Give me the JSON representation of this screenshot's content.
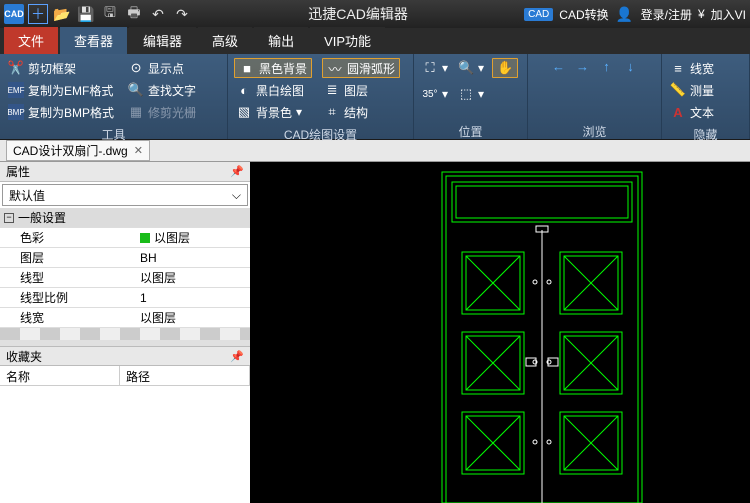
{
  "app": {
    "title": "迅捷CAD编辑器"
  },
  "titlebar_right": {
    "cad_label": "CAD",
    "convert": "CAD转换",
    "login": "登录/注册",
    "vip_prefix": "¥",
    "vip": "加入VI"
  },
  "tabs": {
    "file": "文件",
    "viewer": "查看器",
    "editor": "编辑器",
    "advanced": "高级",
    "output": "输出",
    "vip": "VIP功能"
  },
  "ribbon": {
    "group1": {
      "label": "工具",
      "items": [
        "剪切框架",
        "复制为EMF格式",
        "复制为BMP格式",
        "显示点",
        "查找文字",
        "修剪光栅"
      ]
    },
    "group2": {
      "label": "CAD绘图设置",
      "items": [
        "黑色背景",
        "黑白绘图",
        "背景色",
        "圆滑弧形",
        "图层",
        "结构"
      ]
    },
    "group3": {
      "label": "位置"
    },
    "group4": {
      "label": "浏览"
    },
    "group5": {
      "label": "隐藏",
      "items": [
        "线宽",
        "测量",
        "文本"
      ]
    }
  },
  "document": {
    "tab": "CAD设计双扇门-.dwg"
  },
  "props": {
    "title": "属性",
    "default": "默认值",
    "section": "一般设置",
    "rows": [
      {
        "k": "色彩",
        "v": "以图层",
        "swatch": true
      },
      {
        "k": "图层",
        "v": "BH"
      },
      {
        "k": "线型",
        "v": "以图层"
      },
      {
        "k": "线型比例",
        "v": "1"
      },
      {
        "k": "线宽",
        "v": "以图层"
      }
    ]
  },
  "fav": {
    "title": "收藏夹",
    "col1": "名称",
    "col2": "路径"
  }
}
